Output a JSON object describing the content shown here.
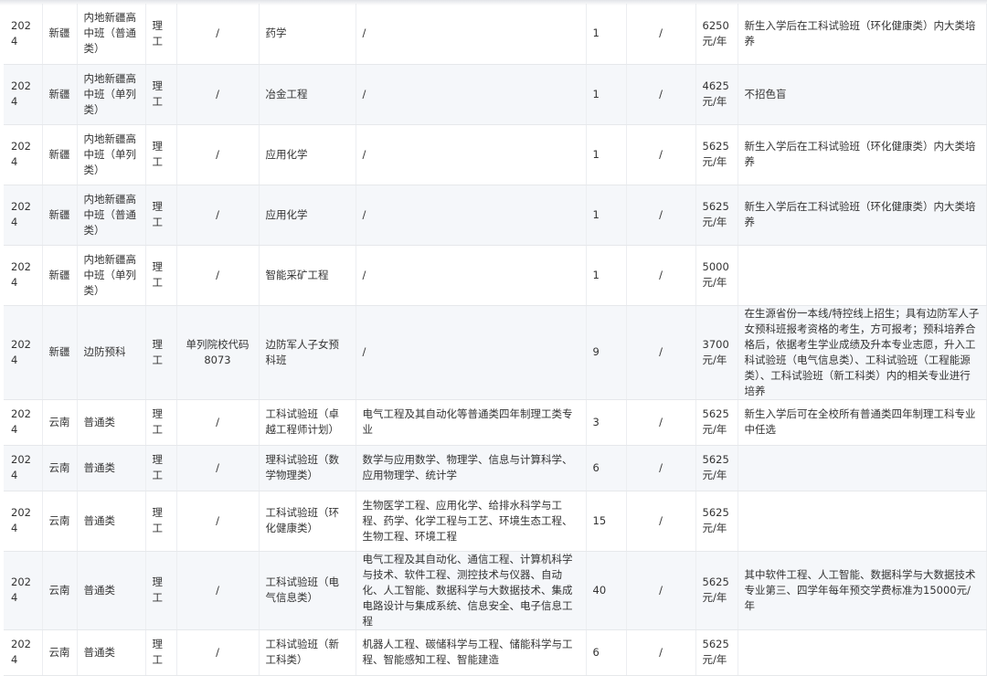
{
  "rows": [
    {
      "year": "2024",
      "province": "新疆",
      "category": "内地新疆高中班（普通类）",
      "subject": "理工",
      "code": "/",
      "major": "药学",
      "includes": "/",
      "count": "1",
      "duration": "/",
      "fee": "6250元/年",
      "remark": "新生入学后在工科试验班（环化健康类）内大类培养"
    },
    {
      "year": "2024",
      "province": "新疆",
      "category": "内地新疆高中班（单列类）",
      "subject": "理工",
      "code": "/",
      "major": "冶金工程",
      "includes": "/",
      "count": "1",
      "duration": "/",
      "fee": "4625元/年",
      "remark": "不招色盲"
    },
    {
      "year": "2024",
      "province": "新疆",
      "category": "内地新疆高中班（单列类）",
      "subject": "理工",
      "code": "/",
      "major": "应用化学",
      "includes": "/",
      "count": "1",
      "duration": "/",
      "fee": "5625元/年",
      "remark": "新生入学后在工科试验班（环化健康类）内大类培养"
    },
    {
      "year": "2024",
      "province": "新疆",
      "category": "内地新疆高中班（普通类）",
      "subject": "理工",
      "code": "/",
      "major": "应用化学",
      "includes": "/",
      "count": "1",
      "duration": "/",
      "fee": "5625元/年",
      "remark": "新生入学后在工科试验班（环化健康类）内大类培养"
    },
    {
      "year": "2024",
      "province": "新疆",
      "category": "内地新疆高中班（单列类）",
      "subject": "理工",
      "code": "/",
      "major": "智能采矿工程",
      "includes": "/",
      "count": "1",
      "duration": "/",
      "fee": "5000元/年",
      "remark": ""
    },
    {
      "year": "2024",
      "province": "新疆",
      "category": "边防预科",
      "subject": "理工",
      "code": "单列院校代码8073",
      "major": "边防军人子女预科班",
      "includes": "/",
      "count": "9",
      "duration": "/",
      "fee": "3700元/年",
      "remark": "在生源省份一本线/特控线上招生；具有边防军人子女预科班报考资格的考生，方可报考；预科培养合格后，依据考生学业成绩及升本专业志愿，升入工科试验班（电气信息类）、工科试验班（工程能源类）、工科试验班（新工科类）内的相关专业进行培养"
    },
    {
      "year": "2024",
      "province": "云南",
      "category": "普通类",
      "subject": "理工",
      "code": "/",
      "major": "工科试验班（卓越工程师计划）",
      "includes": "电气工程及其自动化等普通类四年制理工类专业",
      "count": "3",
      "duration": "/",
      "fee": "5625元/年",
      "remark": "新生入学后可在全校所有普通类四年制理工科专业中任选"
    },
    {
      "year": "2024",
      "province": "云南",
      "category": "普通类",
      "subject": "理工",
      "code": "/",
      "major": "理科试验班（数学物理类）",
      "includes": "数学与应用数学、物理学、信息与计算科学、应用物理学、统计学",
      "count": "6",
      "duration": "/",
      "fee": "5625元/年",
      "remark": ""
    },
    {
      "year": "2024",
      "province": "云南",
      "category": "普通类",
      "subject": "理工",
      "code": "/",
      "major": "工科试验班（环化健康类）",
      "includes": "生物医学工程、应用化学、给排水科学与工程、药学、化学工程与工艺、环境生态工程、生物工程、环境工程",
      "count": "15",
      "duration": "/",
      "fee": "5625元/年",
      "remark": ""
    },
    {
      "year": "2024",
      "province": "云南",
      "category": "普通类",
      "subject": "理工",
      "code": "/",
      "major": "工科试验班（电气信息类）",
      "includes": "电气工程及其自动化、通信工程、计算机科学与技术、软件工程、测控技术与仪器、自动化、人工智能、数据科学与大数据技术、集成电路设计与集成系统、信息安全、电子信息工程",
      "count": "40",
      "duration": "/",
      "fee": "5625元/年",
      "remark": "其中软件工程、人工智能、数据科学与大数据技术专业第三、四学年每年预交学费标准为15000元/年"
    },
    {
      "year": "2024",
      "province": "云南",
      "category": "普通类",
      "subject": "理工",
      "code": "/",
      "major": "工科试验班（新工科类）",
      "includes": "机器人工程、碳储科学与工程、储能科学与工程、智能感知工程、智能建造",
      "count": "6",
      "duration": "/",
      "fee": "5625元/年",
      "remark": ""
    }
  ]
}
